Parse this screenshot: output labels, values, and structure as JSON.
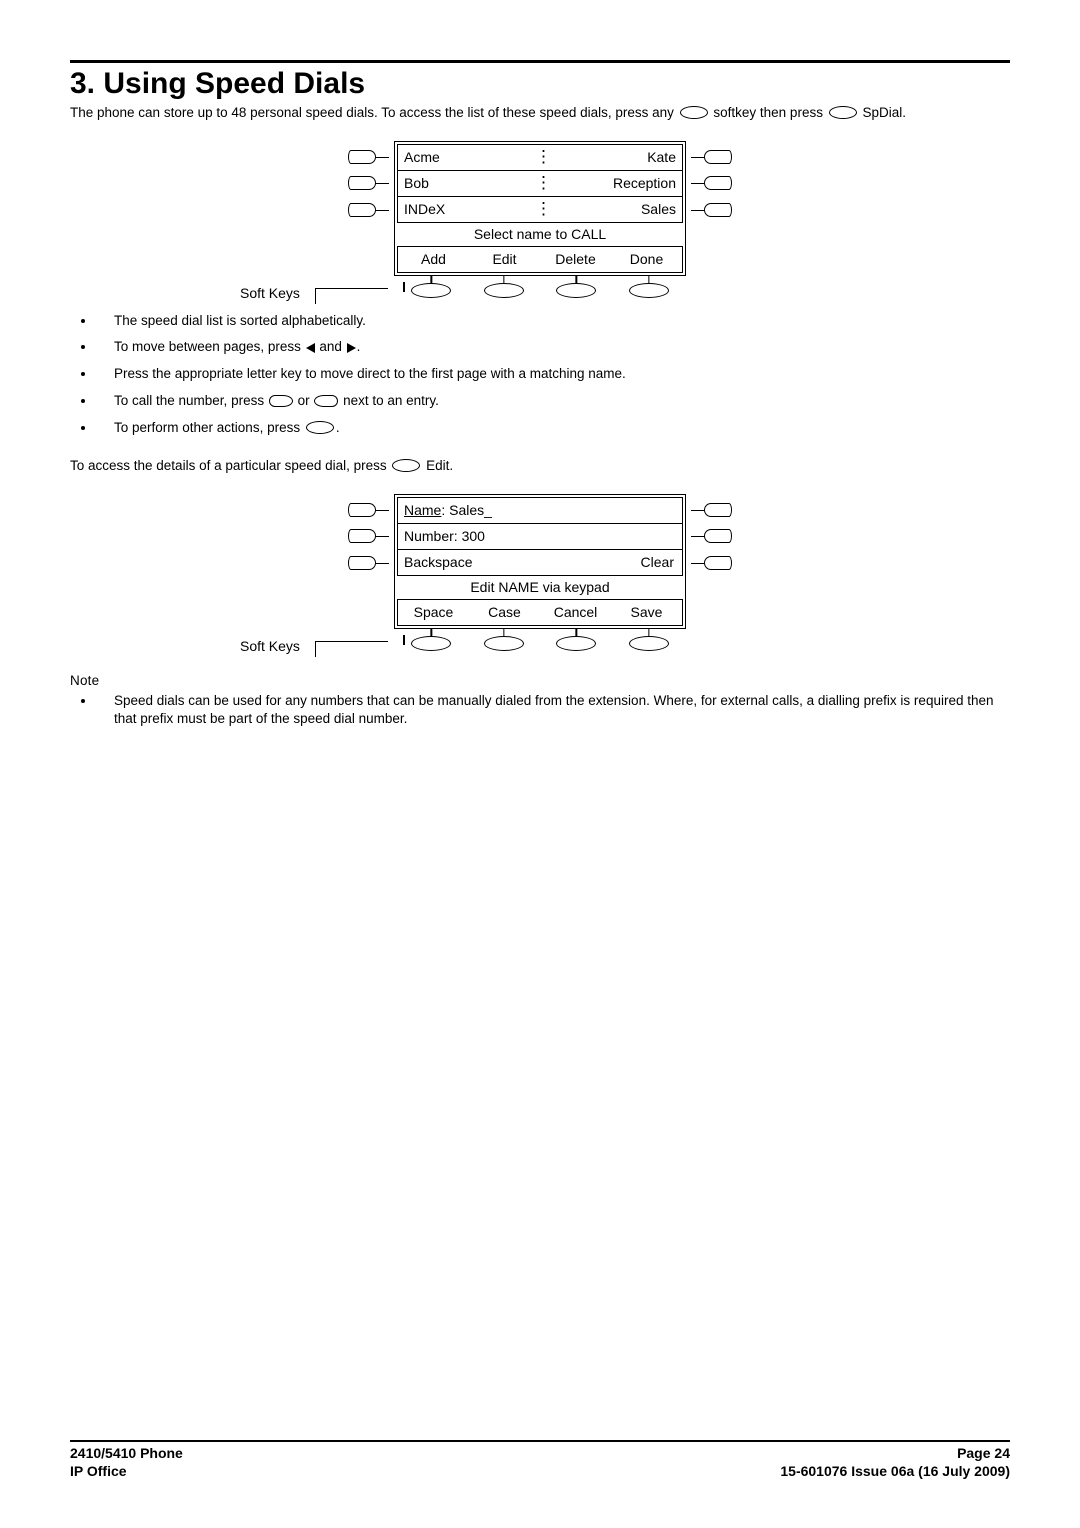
{
  "heading": "3. Using Speed Dials",
  "intro_part1": "The phone can store up to 48 personal speed dials. To access the list of these speed dials, press any ",
  "intro_part2": " softkey then press ",
  "intro_label": " SpDial.",
  "diagram1": {
    "rows": [
      {
        "left": "Acme",
        "right": "Kate"
      },
      {
        "left": "Bob",
        "right": "Reception"
      },
      {
        "left": "INDeX",
        "right": "Sales"
      }
    ],
    "hint": "Select name to CALL",
    "softkeys": [
      "Add",
      "Edit",
      "Delete",
      "Done"
    ],
    "sk_label": "Soft Keys"
  },
  "bullets1": [
    "The speed dial list is sorted alphabetically.",
    "To move between pages, press ",
    "Press the appropriate letter key to move direct to the first page with a matching name.",
    "To call the number, press ",
    "To perform other actions, press "
  ],
  "b2_tail": " and ",
  "b2_end": ".",
  "b4_mid": " or ",
  "b4_end": " next to an entry.",
  "b5_end": ".",
  "access_line_pre": "To access the details of a particular speed dial, press ",
  "access_line_post": " Edit.",
  "diagram2": {
    "row1_label": "Name",
    "row1_value": ": Sales_",
    "row2": "Number: 300",
    "row3_left": "Backspace",
    "row3_right": "Clear",
    "hint": "Edit NAME via keypad",
    "softkeys": [
      "Space",
      "Case",
      "Cancel",
      "Save"
    ],
    "sk_label": "Soft Keys"
  },
  "note_heading": "Note",
  "note_bullet": "Speed dials can be used for any numbers that can be manually dialed from the extension. Where, for external calls, a dialling prefix is required then that prefix must be part of the speed dial number.",
  "footer": {
    "left1": "2410/5410 Phone",
    "left2": "IP Office",
    "right1": "Page 24",
    "right2": "15-601076 Issue 06a (16 July 2009)"
  }
}
